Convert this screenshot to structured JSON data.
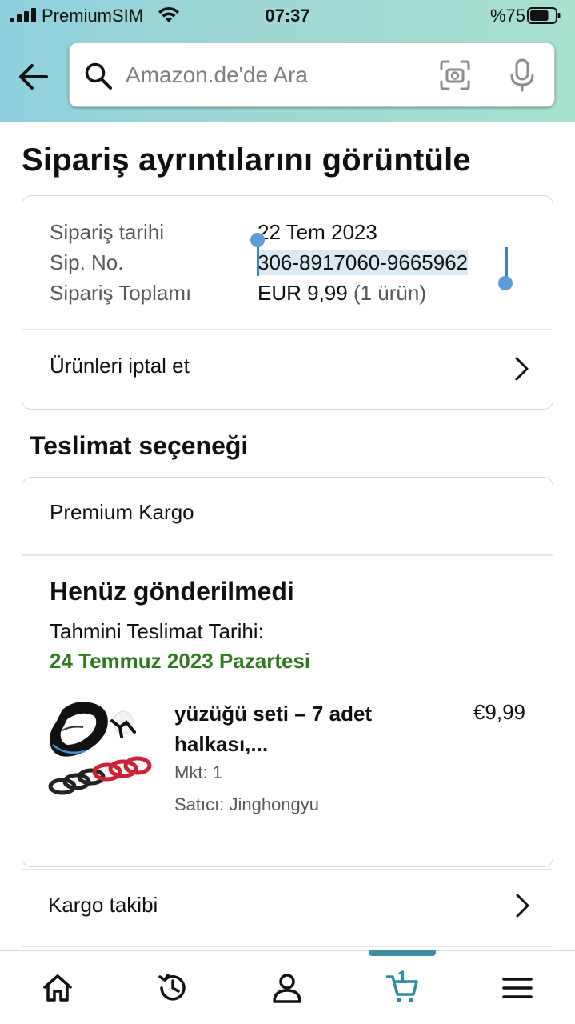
{
  "status_bar": {
    "carrier": "PremiumSIM",
    "time": "07:37",
    "battery_percent": "%75",
    "battery_level": 0.75
  },
  "search": {
    "placeholder": "Amazon.de'de Ara"
  },
  "page": {
    "title": "Sipariş ayrıntılarını görüntüle"
  },
  "order_summary": {
    "date_label": "Sipariş tarihi",
    "date_value": "22 Tem 2023",
    "number_label": "Sip. No.",
    "number_value": "306-8917060-9665962",
    "total_label": "Sipariş Toplamı",
    "total_value": "EUR 9,99",
    "total_items": "(1 ürün)",
    "cancel_label": "Ürünleri iptal et"
  },
  "delivery": {
    "section_title": "Teslimat seçeneği",
    "method": "Premium Kargo",
    "status": "Henüz gönderilmedi",
    "eta_label": "Tahmini Teslimat Tarihi:",
    "eta_date": "24 Temmuz 2023 Pazartesi",
    "eta_color": "#2f7a1f"
  },
  "product": {
    "title_line1": "yüzüğü seti – 7 adet",
    "title_line2": "halkası,...",
    "price": "€9,99",
    "quantity": "Mkt: 1",
    "seller": "Satıcı: Jinghongyu"
  },
  "tracking": {
    "label": "Kargo takibi"
  },
  "tabbar": {
    "cart_count": "1",
    "active_tab": "cart",
    "accent": "#3f8fa1",
    "tabs": [
      "home-icon",
      "history-icon",
      "account-icon",
      "cart-icon",
      "menu-icon"
    ]
  }
}
